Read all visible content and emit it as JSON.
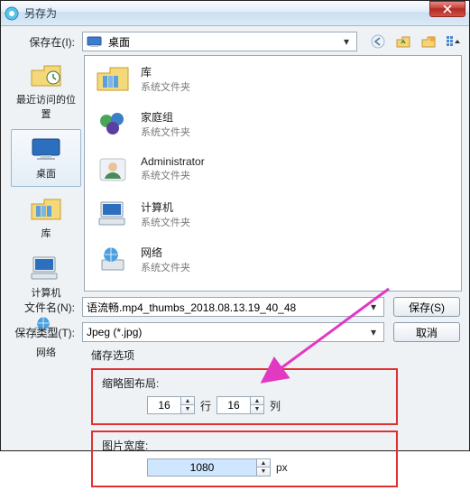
{
  "titlebar": {
    "title": "另存为"
  },
  "saveIn": {
    "label": "保存在(I):",
    "value": "桌面"
  },
  "sidebar": [
    {
      "label": "最近访问的位置"
    },
    {
      "label": "桌面"
    },
    {
      "label": "库"
    },
    {
      "label": "计算机"
    },
    {
      "label": "网络"
    }
  ],
  "files": [
    {
      "title": "库",
      "sub": "系统文件夹"
    },
    {
      "title": "家庭组",
      "sub": "系统文件夹"
    },
    {
      "title": "Administrator",
      "sub": "系统文件夹"
    },
    {
      "title": "计算机",
      "sub": "系统文件夹"
    },
    {
      "title": "网络",
      "sub": "系统文件夹"
    }
  ],
  "filename": {
    "label": "文件名(N):",
    "value": "语流畅.mp4_thumbs_2018.08.13.19_40_48"
  },
  "filetype": {
    "label": "保存类型(T):",
    "value": "Jpeg (*.jpg)"
  },
  "buttons": {
    "save": "保存(S)",
    "cancel": "取消"
  },
  "storage": {
    "title": "储存选项",
    "thumbLayout": {
      "label": "缩略图布局:",
      "rows": "16",
      "rowsUnit": "行",
      "cols": "16",
      "colsUnit": "列"
    },
    "imgWidth": {
      "label": "图片宽度:",
      "value": "1080",
      "unit": "px"
    }
  }
}
